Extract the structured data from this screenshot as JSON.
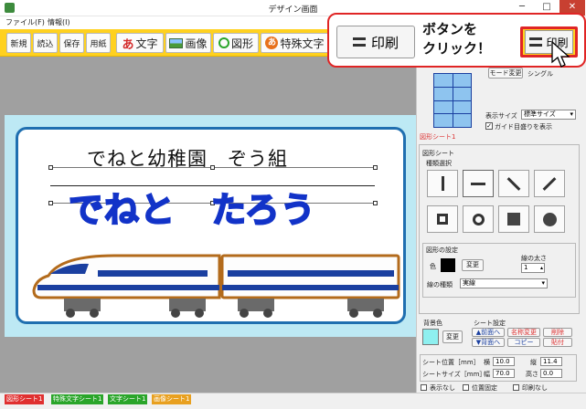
{
  "window": {
    "title": "デザイン画面",
    "minimize": "─",
    "maximize": "□",
    "close": "✕"
  },
  "menu": [
    {
      "label": "ファイル(F)"
    },
    {
      "label": "情報(I)"
    }
  ],
  "toolbar": {
    "new": "新規",
    "open": "読込",
    "save": "保存",
    "paper": "用紙",
    "text": "文字",
    "image": "画像",
    "shape": "図形",
    "special_text": "特殊文字",
    "print": "印刷"
  },
  "canvas": {
    "line1": "でねと幼稚園　ぞう組",
    "line2": "でねと　たろう"
  },
  "panel": {
    "mode_change": "モード変更",
    "single": "シングル",
    "display_size_label": "表示サイズ",
    "display_size_value": "標準サイズ",
    "guide_label": "ガイド目盛りを表示",
    "guide_checked": true,
    "shape_sheet_title": "図形シート1",
    "shape_sheet_group": "図形シート",
    "type_select": "種類選択",
    "shape_settings": "図形の設定",
    "color_label": "色",
    "change": "変更",
    "line_width_label": "線の太さ",
    "line_width_value": "1",
    "line_type_label": "線の種類",
    "line_type_value": "実線",
    "bg_color_label": "背景色",
    "sheet_settings": "シート設定",
    "bring_front": "▲前面へ",
    "send_back": "▼背面へ",
    "rename": "名称変更",
    "copy": "コピー",
    "delete": "削除",
    "paste": "貼付",
    "sheet_pos_label": "シート位置［mm］",
    "sheet_size_label": "シートサイズ［mm］",
    "x_label": "横",
    "x_value": "10.0",
    "y_label": "縦",
    "y_value": "11.4",
    "w_label": "幅",
    "w_value": "70.0",
    "h_label": "高さ",
    "h_value": "0.0",
    "hide_label": "表示なし",
    "lock_label": "位置固定",
    "noprint_label": "印刷なし"
  },
  "sheet_tabs": [
    {
      "label": "図形シート1",
      "color": "#e03030"
    },
    {
      "label": "特殊文字シート1",
      "color": "#2aa52a"
    },
    {
      "label": "文字シート1",
      "color": "#2aa52a"
    },
    {
      "label": "画像シート1",
      "color": "#e8a020"
    }
  ],
  "callout": {
    "button_label": "印刷",
    "text_line1": "ボタンを",
    "text_line2": "クリック！"
  },
  "colors": {
    "toolbar": "#ffd11f",
    "card_border": "#1f6fb0",
    "name_text": "#1233c8",
    "callout_border": "#e02525",
    "sheet_bg": "#bde9f4"
  }
}
